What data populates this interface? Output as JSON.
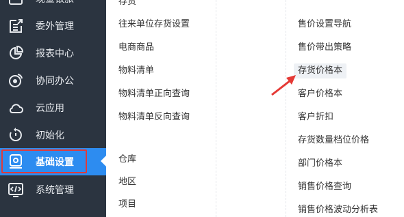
{
  "sidebar": {
    "items": [
      {
        "label": "现金银旅",
        "icon": "wallet-icon"
      },
      {
        "label": "委外管理",
        "icon": "outsource-icon"
      },
      {
        "label": "报表中心",
        "icon": "pie-chart-icon"
      },
      {
        "label": "协同办公",
        "icon": "collaboration-icon"
      },
      {
        "label": "云应用",
        "icon": "cloud-icon"
      },
      {
        "label": "初始化",
        "icon": "refresh-icon"
      },
      {
        "label": "基础设置",
        "icon": "settings-icon"
      },
      {
        "label": "系统管理",
        "icon": "code-window-icon"
      }
    ],
    "active_color": "#2d8cf0",
    "bg_color": "#2b3440"
  },
  "menu": {
    "col1": [
      "存货",
      "往来单位存货设置",
      "电商商品",
      "物料清单",
      "物料清单正向查询",
      "物料清单反向查询",
      "仓库",
      "地区",
      "项目"
    ],
    "col2": [
      "售价设置导航",
      "售价带出策略",
      "存货价格本",
      "客户价格本",
      "客户折扣",
      "存货数量档位价格",
      "部门价格本",
      "销售价格查询",
      "销售价格波动分析表"
    ]
  }
}
